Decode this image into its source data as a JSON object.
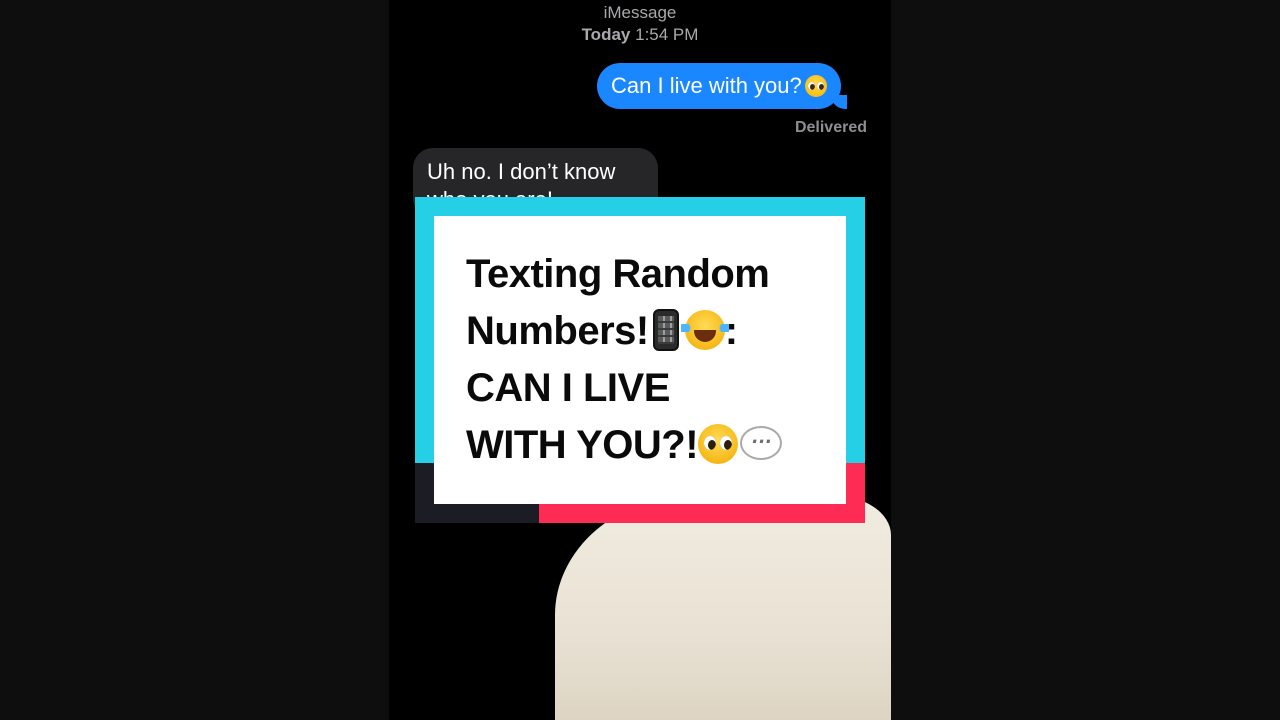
{
  "conversation": {
    "service_label": "iMessage",
    "timestamp_day": "Today",
    "timestamp_time": "1:54 PM",
    "messages": [
      {
        "direction": "outgoing",
        "text": "Can I live with you?",
        "emoji": "pleading-face"
      },
      {
        "direction": "incoming",
        "text": "Uh no. I don’t know who you are!"
      }
    ],
    "status": "Delivered"
  },
  "title_card": {
    "line1": "Texting Random",
    "line2": "Numbers!",
    "line2_suffix": ":",
    "line3": "CAN I LIVE",
    "line4": "WITH YOU?!",
    "emojis": [
      "mobile-phone",
      "tears-of-joy",
      "pleading-face",
      "speech-balloon"
    ]
  },
  "colors": {
    "outgoing_bubble": "#1a86ff",
    "incoming_bubble": "#262629",
    "card_cyan": "#25d0e6",
    "card_red": "#fe2c55"
  }
}
